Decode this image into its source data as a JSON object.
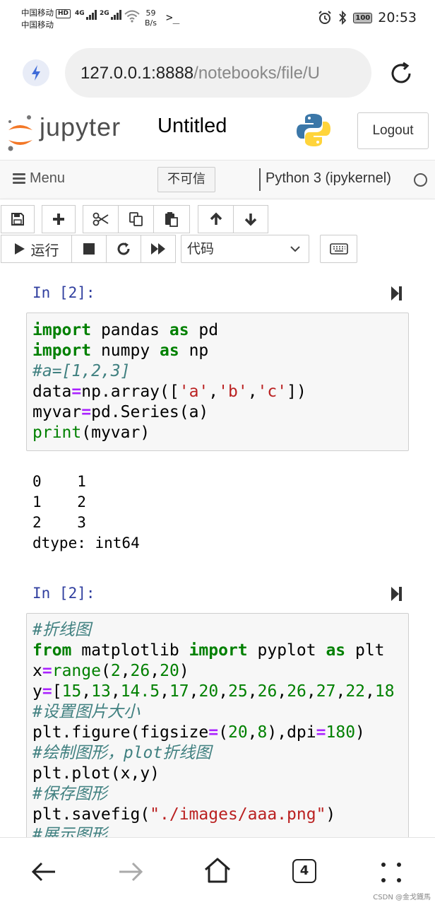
{
  "status_bar": {
    "carrier1": "中国移动",
    "carrier1_badge": "HD",
    "carrier2": "中国移动",
    "net1": "4G",
    "net2": "2G",
    "speed_value": "59",
    "speed_unit": "B/s",
    "battery": "100",
    "time": "20:53"
  },
  "browser": {
    "url_host": "127.0.0.1:8888",
    "url_path": "/notebooks/file/U"
  },
  "jupyter": {
    "logo_text": "jupyter",
    "notebook_title": "Untitled",
    "logout_label": "Logout"
  },
  "menubar": {
    "menu_label": "Menu",
    "untrusted_label": "不可信",
    "kernel_name": "Python 3 (ipykernel)"
  },
  "toolbar": {
    "run_label": "运行",
    "cell_type": "代码"
  },
  "cells": [
    {
      "prompt": "In [2]:",
      "lines": [
        [
          [
            "kw",
            "import"
          ],
          [
            "",
            " pandas "
          ],
          [
            "kw",
            "as"
          ],
          [
            "",
            " pd"
          ]
        ],
        [
          [
            "kw",
            "import"
          ],
          [
            "",
            " numpy "
          ],
          [
            "kw",
            "as"
          ],
          [
            "",
            " np"
          ]
        ],
        [
          [
            "cm",
            "#a=[1,2,3]"
          ]
        ],
        [
          [
            "",
            "data"
          ],
          [
            "op",
            "="
          ],
          [
            "",
            "np.array(["
          ],
          [
            "str",
            "'a'"
          ],
          [
            "",
            ","
          ],
          [
            "str",
            "'b'"
          ],
          [
            "",
            ","
          ],
          [
            "str",
            "'c'"
          ],
          [
            "",
            "])"
          ]
        ],
        [
          [
            "",
            "myvar"
          ],
          [
            "op",
            "="
          ],
          [
            "",
            "pd.Series(a)"
          ]
        ],
        [
          [
            "bi",
            "print"
          ],
          [
            "",
            "(myvar)"
          ]
        ]
      ],
      "output": [
        "0    1",
        "1    2",
        "2    3",
        "dtype: int64"
      ]
    },
    {
      "prompt": "In [2]:",
      "lines": [
        [
          [
            "cm",
            "#折线图"
          ]
        ],
        [
          [
            "kw",
            "from"
          ],
          [
            "",
            " matplotlib "
          ],
          [
            "kw",
            "import"
          ],
          [
            "",
            " pyplot "
          ],
          [
            "kw",
            "as"
          ],
          [
            "",
            " plt"
          ]
        ],
        [
          [
            "",
            "x"
          ],
          [
            "op",
            "="
          ],
          [
            "bi",
            "range"
          ],
          [
            "",
            "("
          ],
          [
            "num",
            "2"
          ],
          [
            "",
            ","
          ],
          [
            "num",
            "26"
          ],
          [
            "",
            ","
          ],
          [
            "num",
            "20"
          ],
          [
            "",
            ")"
          ]
        ],
        [
          [
            "",
            "y"
          ],
          [
            "op",
            "="
          ],
          [
            "",
            "["
          ],
          [
            "num",
            "15"
          ],
          [
            "",
            ","
          ],
          [
            "num",
            "13"
          ],
          [
            "",
            ","
          ],
          [
            "num",
            "14.5"
          ],
          [
            "",
            ","
          ],
          [
            "num",
            "17"
          ],
          [
            "",
            ","
          ],
          [
            "num",
            "20"
          ],
          [
            "",
            ","
          ],
          [
            "num",
            "25"
          ],
          [
            "",
            ","
          ],
          [
            "num",
            "26"
          ],
          [
            "",
            ","
          ],
          [
            "num",
            "26"
          ],
          [
            "",
            ","
          ],
          [
            "num",
            "27"
          ],
          [
            "",
            ","
          ],
          [
            "num",
            "22"
          ],
          [
            "",
            ","
          ],
          [
            "num",
            "18"
          ]
        ],
        [
          [
            "cm",
            "#设置图片大小"
          ]
        ],
        [
          [
            "",
            "plt.figure(figsize"
          ],
          [
            "op",
            "="
          ],
          [
            "",
            "("
          ],
          [
            "num",
            "20"
          ],
          [
            "",
            ","
          ],
          [
            "num",
            "8"
          ],
          [
            "",
            "),dpi"
          ],
          [
            "op",
            "="
          ],
          [
            "num",
            "180"
          ],
          [
            "",
            ")"
          ]
        ],
        [
          [
            "cm",
            "#绘制图形，plot折线图"
          ]
        ],
        [
          [
            "",
            "plt.plot(x,y)"
          ]
        ],
        [
          [
            "cm",
            "#保存图形"
          ]
        ],
        [
          [
            "",
            "plt.savefig("
          ],
          [
            "str",
            "\"./images/aaa.png\""
          ],
          [
            "",
            ")"
          ]
        ],
        [
          [
            "cm",
            "#展示图形"
          ]
        ]
      ]
    }
  ],
  "bottom_nav": {
    "tab_count": "4",
    "watermark": "CSDN @金戈鐡馬"
  }
}
